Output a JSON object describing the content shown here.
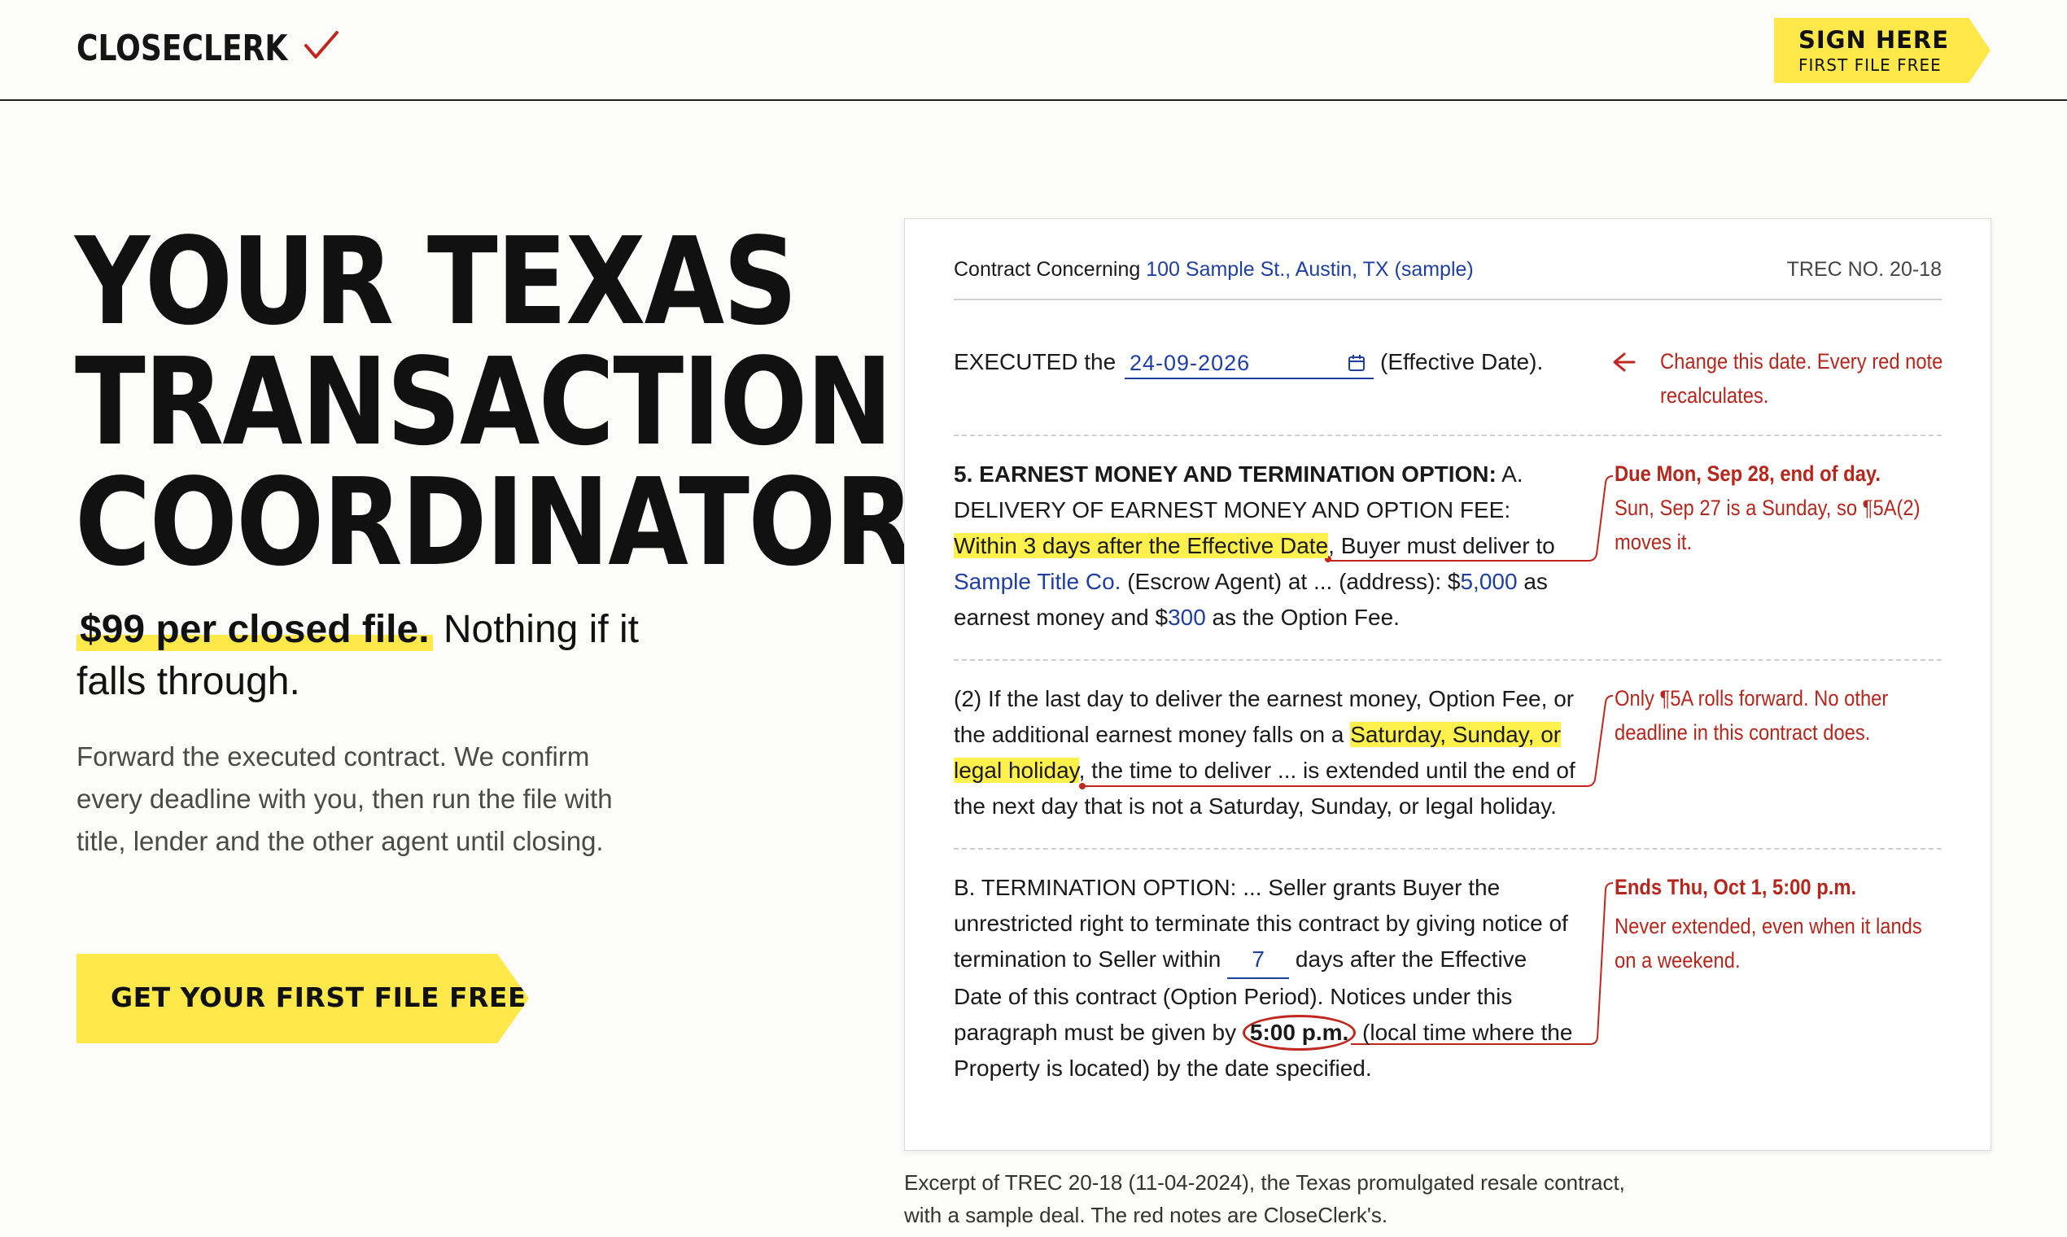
{
  "header": {
    "logo": "CLOSECLERK",
    "sign_main": "SIGN HERE",
    "sign_sub": "FIRST FILE FREE"
  },
  "hero": {
    "headline": [
      "YOUR TEXAS",
      "TRANSACTION",
      "COORDINATOR"
    ],
    "price_highlight": "$99 per closed file.",
    "price_rest": " Nothing if it falls through.",
    "description": "Forward the executed contract. We confirm every deadline with you, then run the file with title, lender and the other agent until closing.",
    "cta_label": "GET YOUR FIRST FILE FREE"
  },
  "contract": {
    "concerning_label": "Contract Concerning ",
    "property": "100 Sample St., Austin, TX (sample)",
    "form_no": "TREC NO. 20-18",
    "executed_label": "EXECUTED the ",
    "effective_date": "24-09-2026",
    "effective_suffix": "(Effective Date).",
    "note_date": "Change this date. Every red note recalculates.",
    "sec5_heading": "5. EARNEST MONEY AND TERMINATION OPTION:",
    "sec5_a": " A. DELIVERY OF EARNEST MONEY AND OPTION FEE:",
    "sec5_within": "Within 3 days after the Effective Date",
    "sec5_buyer": ", Buyer must deliver to",
    "title_co": "Sample Title Co.",
    "escrow_text": " (Escrow Agent) at ... (address): $",
    "earnest_amount": "5,000",
    "as_text": " as",
    "earnest_text": "earnest money and $",
    "option_fee": "300",
    "option_text": " as the Option Fee.",
    "note_due_bold": "Due Mon, Sep 28, end of day.",
    "note_due_detail": "Sun, Sep 27 is a Sunday, so ¶5A(2) moves it.",
    "para2_line1": "(2) If the last day to deliver the earnest money, Option Fee, or",
    "para2_line2a": "the additional earnest money falls on a ",
    "para2_hl1": "Saturday, Sunday, or",
    "para2_hl2": "legal holiday",
    "para2_line3b": ", the time to deliver ... is extended until the end of",
    "para2_line4": "the next day that is not a Saturday, Sunday, or legal holiday.",
    "note_only": "Only ¶5A rolls forward. No other deadline in this contract does.",
    "termB_line1": "B. TERMINATION OPTION: ... Seller grants Buyer the",
    "termB_line2": "unrestricted right to terminate this contract by giving notice of",
    "termB_line3a": "termination to Seller within ",
    "option_days": "7",
    "termB_line3b": " days after the Effective",
    "termB_line4": "Date of this contract (Option Period). Notices under this",
    "termB_line5a": "paragraph must be given by ",
    "termB_time": "5:00 p.m.",
    "termB_line5b": " (local time where the",
    "termB_line6": "Property is located) by the date specified.",
    "note_ends_bold": "Ends Thu, Oct 1, 5:00 p.m.",
    "note_ends_detail": "Never extended, even when it lands on a weekend."
  },
  "caption": "Excerpt of TREC 20-18 (11-04-2024), the Texas promulgated resale contract, with a sample deal. The red notes are CloseClerk's.",
  "colors": {
    "accent": "#ffe84a",
    "note_red": "#b5271d",
    "link_blue": "#1f3fa3"
  }
}
